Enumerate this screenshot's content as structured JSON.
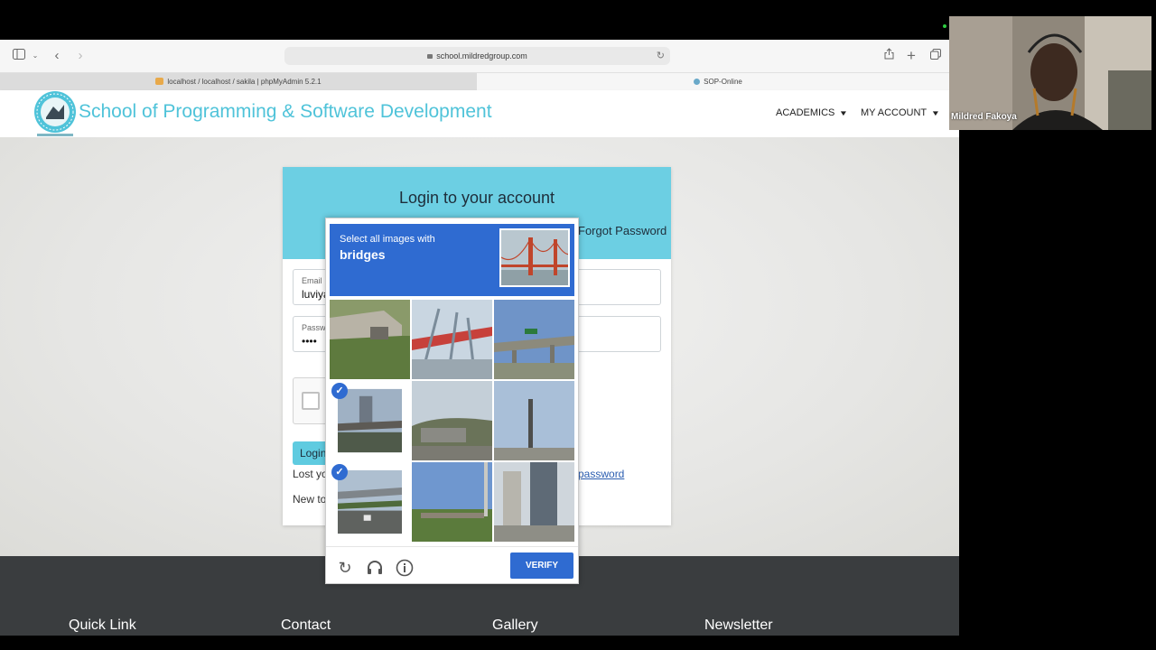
{
  "browser": {
    "url": "school.mildredgroup.com",
    "tabs": [
      {
        "label": "localhost / localhost / sakila | phpMyAdmin 5.2.1",
        "active": false
      },
      {
        "label": "SOP-Online",
        "active": true
      }
    ]
  },
  "site": {
    "title": "School of Programming & Software Development",
    "nav": [
      {
        "label": "ACADEMICS"
      },
      {
        "label": "MY ACCOUNT"
      }
    ]
  },
  "login": {
    "title": "Login to your account",
    "forgot_header": "Forgot Password",
    "email_label": "Email",
    "email_value": "luviya",
    "password_label": "Password",
    "password_value": "••••",
    "login_button": "Login",
    "lost_text": "Lost yo",
    "reset_link": "password",
    "new_text": "New to"
  },
  "captcha_challenge": {
    "instruction": "Select all images with",
    "target": "bridges",
    "selected_tiles": [
      3,
      6
    ],
    "verify_button": "VERIFY",
    "footer_icons": [
      "reload-icon",
      "audio-icon",
      "info-icon"
    ]
  },
  "footer": {
    "columns": [
      "Quick Link",
      "Contact",
      "Gallery",
      "Newsletter"
    ]
  },
  "webcam": {
    "participant": "Mildred Fakoya"
  },
  "colors": {
    "brand_cyan": "#4fc3d9",
    "login_header": "#6ccfe3",
    "recaptcha_blue": "#2f6bd1",
    "footer": "#3a3d3f"
  }
}
